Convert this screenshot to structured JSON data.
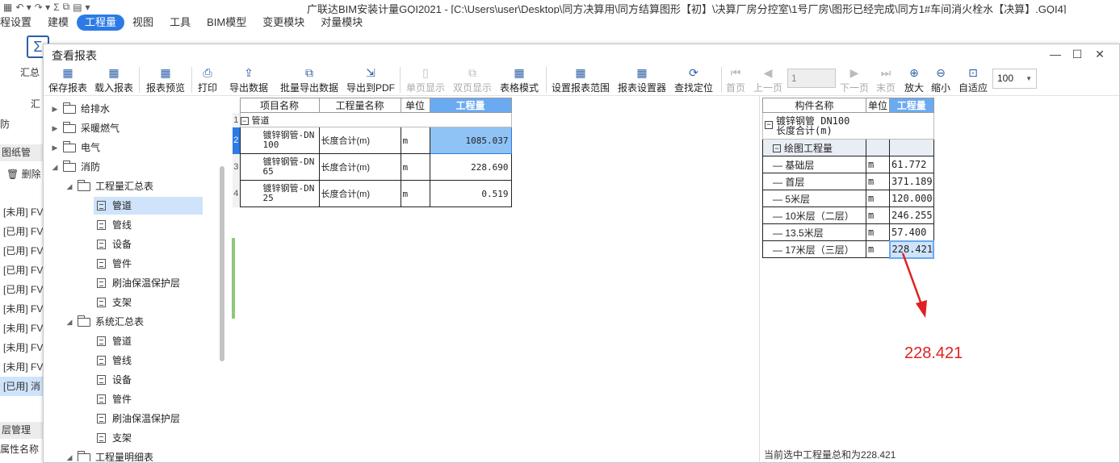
{
  "app": {
    "title": "广联达BIM安装计量GQI2021 - [C:\\Users\\user\\Desktop\\同方决算用\\同方结算图形【初】\\决算厂房分控室\\1号厂房\\图形已经完成\\同方1#车间消火栓水【决算】.GQI4]",
    "quick_access": [
      "▦",
      "↶ ▾",
      "↷ ▾",
      "Σ",
      "⧉",
      "▤",
      "▾"
    ]
  },
  "main_tabs": [
    "程设置",
    "建模",
    "工程量",
    "视图",
    "工具",
    "BIM模型",
    "变更模块",
    "对量模块"
  ],
  "background": {
    "sum_label": "汇总",
    "sum_label2": "汇",
    "search_hint": "防",
    "drawing_tab": "图纸管",
    "delete_label": "删除",
    "rows": [
      "[未用] FV",
      "[已用] FV",
      "[已用] FV",
      "[已用] FV",
      "[已用] FV",
      "[未用] FV",
      "[未用] FV",
      "[未用] FV",
      "[未用] FV",
      "[已用] 消"
    ],
    "layer_mgmt": "层管理",
    "prop_name": "属性名称"
  },
  "dialog": {
    "title": "查看报表",
    "toolbar": {
      "save_report": "保存报表",
      "load_report": "载入报表",
      "preview": "报表预览",
      "print": "打印",
      "export_data": "导出数据",
      "batch_export": "批量导出数据",
      "export_pdf": "导出到PDF",
      "single_page": "单页显示",
      "double_page": "双页显示",
      "table_mode": "表格模式",
      "set_range": "设置报表范围",
      "report_setter": "报表设置器",
      "locate": "查找定位",
      "first_page": "首页",
      "prev_page": "上一页",
      "page_value": "1",
      "next_page": "下一页",
      "last_page": "末页",
      "zoom_in": "放大",
      "zoom_out": "缩小",
      "fit": "自适应",
      "zoom_value": "100"
    }
  },
  "tree": [
    {
      "label": "给排水",
      "type": "folder",
      "state": "collapsed"
    },
    {
      "label": "采暖燃气",
      "type": "folder",
      "state": "collapsed"
    },
    {
      "label": "电气",
      "type": "folder",
      "state": "collapsed"
    },
    {
      "label": "消防",
      "type": "folder",
      "state": "expanded"
    },
    {
      "label": "工程量汇总表",
      "type": "folder",
      "state": "expanded"
    },
    {
      "label": "管道",
      "type": "doc",
      "selected": true
    },
    {
      "label": "管线",
      "type": "doc"
    },
    {
      "label": "设备",
      "type": "doc"
    },
    {
      "label": "管件",
      "type": "doc"
    },
    {
      "label": "刷油保温保护层",
      "type": "doc"
    },
    {
      "label": "支架",
      "type": "doc"
    },
    {
      "label": "系统汇总表",
      "type": "folder",
      "state": "expanded"
    },
    {
      "label": "管道",
      "type": "doc"
    },
    {
      "label": "管线",
      "type": "doc"
    },
    {
      "label": "设备",
      "type": "doc"
    },
    {
      "label": "管件",
      "type": "doc"
    },
    {
      "label": "刷油保温保护层",
      "type": "doc"
    },
    {
      "label": "支架",
      "type": "doc"
    },
    {
      "label": "工程量明细表",
      "type": "folder",
      "state": "expanded"
    }
  ],
  "report": {
    "headers": [
      "项目名称",
      "工程量名称",
      "单位",
      "工程量"
    ],
    "row_numbers": [
      "1",
      "2",
      "3",
      "4"
    ],
    "group_label": "管道",
    "rows": [
      {
        "name_line1": "镀锌钢管-DN",
        "name_line2": "100",
        "qty_name": "长度合计(m)",
        "unit": "m",
        "value": "1085.037"
      },
      {
        "name_line1": "镀锌钢管-DN",
        "name_line2": "65",
        "qty_name": "长度合计(m)",
        "unit": "m",
        "value": "228.690"
      },
      {
        "name_line1": "镀锌钢管-DN",
        "name_line2": "25",
        "qty_name": "长度合计(m)",
        "unit": "m",
        "value": "0.519"
      }
    ]
  },
  "detail": {
    "headers": [
      "构件名称",
      "单位",
      "工程量"
    ],
    "title_line1": "镀锌钢管 DN100",
    "title_line2": "长度合计(m)",
    "subgroup": "绘图工程量",
    "rows": [
      {
        "floor": "基础层",
        "unit": "m",
        "value": "61.772"
      },
      {
        "floor": "首层",
        "unit": "m",
        "value": "371.189"
      },
      {
        "floor": "5米层",
        "unit": "m",
        "value": "120.000"
      },
      {
        "floor": "10米层（二层）",
        "unit": "m",
        "value": "246.255"
      },
      {
        "floor": "13.5米层",
        "unit": "m",
        "value": "57.400"
      },
      {
        "floor": "17米层（三层）",
        "unit": "m",
        "value": "228.421"
      }
    ],
    "annotation_value": "228.421",
    "annotation_color": "#e02020",
    "status": "当前选中工程量总和为228.421"
  },
  "colors": {
    "accent": "#2c7be5",
    "header_highlight": "#6aaaf0",
    "selection": "#cfe3fa"
  }
}
